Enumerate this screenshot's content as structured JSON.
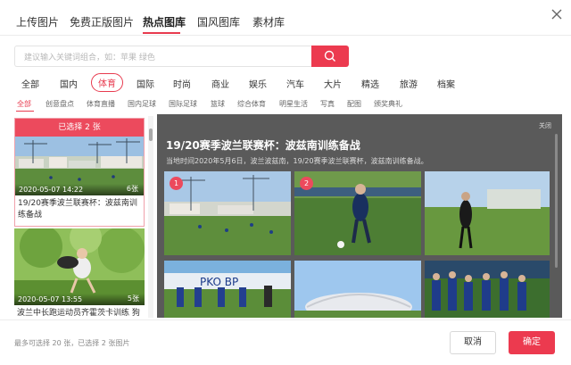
{
  "top_tabs": [
    {
      "label": "上传图片"
    },
    {
      "label": "免费正版图片"
    },
    {
      "label": "热点图库"
    },
    {
      "label": "国风图库"
    },
    {
      "label": "素材库"
    }
  ],
  "active_top_tab": "热点图库",
  "search": {
    "placeholder": "建议输入关键词组合，如：苹果 绿色",
    "value": ""
  },
  "categories": [
    "全部",
    "国内",
    "体育",
    "国际",
    "时尚",
    "商业",
    "娱乐",
    "汽车",
    "大片",
    "精选",
    "旅游",
    "档案"
  ],
  "active_category": "体育",
  "sub_categories": [
    "全部",
    "创意盘点",
    "体育直播",
    "国内足球",
    "国际足球",
    "篮球",
    "综合体育",
    "明星生活",
    "写真",
    "配图",
    "颁奖典礼"
  ],
  "active_sub_category": "全部",
  "left_cards": [
    {
      "banner": "已选择 2 张",
      "date": "2020-05-07 14:22",
      "count": "6张",
      "title": "19/20赛季波兰联赛杯：波兹南训练备战"
    },
    {
      "date": "2020-05-07 13:55",
      "count": "5张",
      "title": "波兰中长跑运动员齐霍茨卡训练 狗"
    }
  ],
  "detail": {
    "close_label": "关闭",
    "title": "19/20赛季波兰联赛杯：波兹南训练备战",
    "description": "当地时间2020年5月6日，波兰波兹南，19/20赛季波兰联赛杯，波兹南训练备战。",
    "selected_numbers": [
      "1",
      "2"
    ]
  },
  "footer": {
    "note": "最多可选择 20 张，已选择 2 张图片",
    "cancel_label": "取消",
    "confirm_label": "确定"
  },
  "colors": {
    "accent": "#ec3a4f",
    "panel_bg": "#5a5a5a"
  }
}
